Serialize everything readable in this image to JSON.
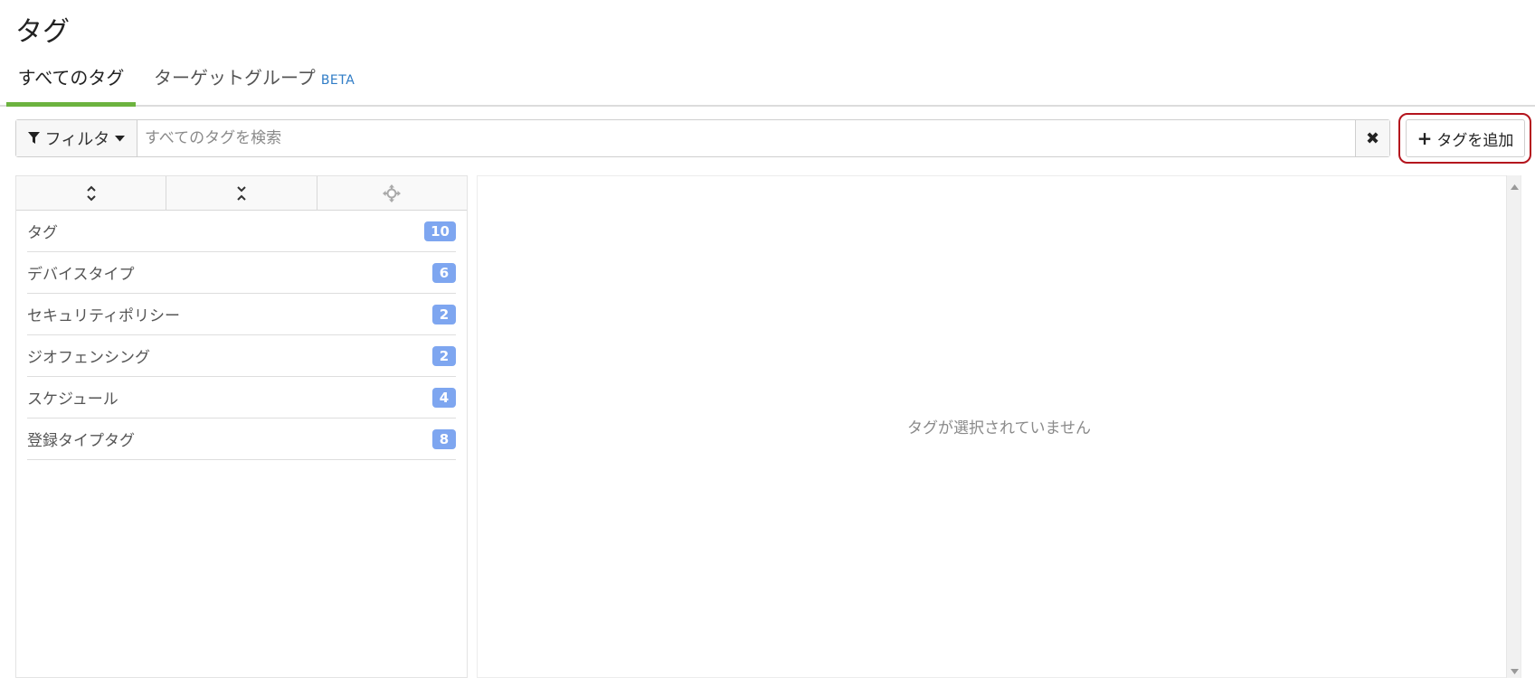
{
  "page": {
    "title": "タグ"
  },
  "tabs": [
    {
      "label": "すべてのタグ",
      "active": true
    },
    {
      "label": "ターゲットグループ",
      "badge": "BETA",
      "active": false
    }
  ],
  "filter": {
    "button_label": "フィルタ",
    "search_placeholder": "すべてのタグを検索",
    "search_value": "",
    "clear_icon": "close-icon"
  },
  "add_tag_button": {
    "label": "タグを追加"
  },
  "toolbar": {
    "icons": [
      "expand-all-icon",
      "collapse-all-icon",
      "move-icon"
    ]
  },
  "tag_categories": [
    {
      "label": "タグ",
      "count": "10"
    },
    {
      "label": "デバイスタイプ",
      "count": "6"
    },
    {
      "label": "セキュリティポリシー",
      "count": "2"
    },
    {
      "label": "ジオフェンシング",
      "count": "2"
    },
    {
      "label": "スケジュール",
      "count": "4"
    },
    {
      "label": "登録タイプタグ",
      "count": "8"
    }
  ],
  "detail": {
    "empty_message": "タグが選択されていません"
  },
  "colors": {
    "active_tab_underline": "#6cb33f",
    "beta": "#2f7cc6",
    "badge": "#7ea6f0",
    "highlight": "#b4141d"
  }
}
